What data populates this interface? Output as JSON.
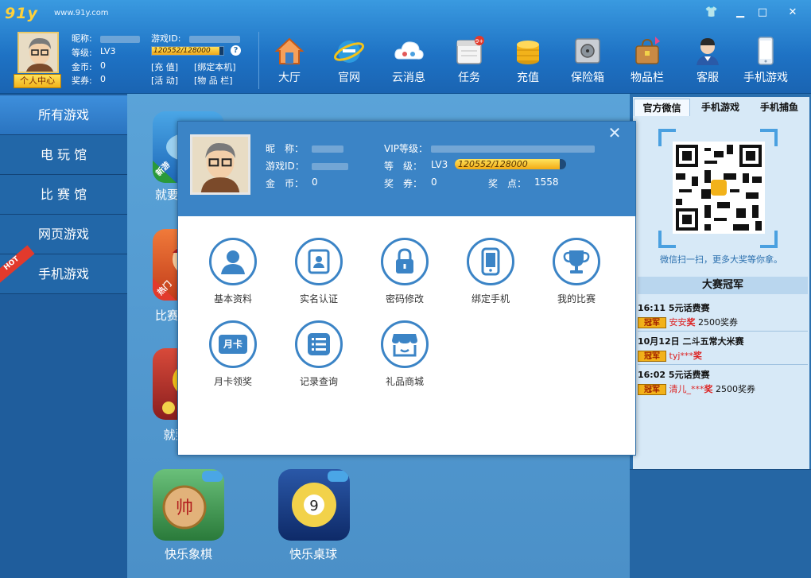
{
  "app": {
    "logo": "91y",
    "site": "www.91y.com"
  },
  "window_controls": {
    "skin": "👕",
    "min": "▁",
    "max": "□",
    "close": "✕"
  },
  "user": {
    "nickname_label": "昵称:",
    "gameid_label": "游戏ID:",
    "level_label": "等级:",
    "level_value": "LV3",
    "exp_text": "120552/128000",
    "exp_fraction": 0.942,
    "gold_label": "金币:",
    "gold_value": "0",
    "coupon_label": "奖券:",
    "coupon_value": "0",
    "recharge": "[充 值]",
    "bind": "[绑定本机]",
    "activity": "[活 动]",
    "bag": "[物 品 栏]",
    "center_btn": "个人中心",
    "help": "?"
  },
  "nav": [
    {
      "label": "大厅",
      "icon": "house-icon",
      "color": "#f07a3a"
    },
    {
      "label": "官网",
      "icon": "ie-icon",
      "color": "#2b9be0"
    },
    {
      "label": "云消息",
      "icon": "cloud-icon",
      "color": "#ffffff"
    },
    {
      "label": "任务",
      "icon": "calendar-icon",
      "color": "#f4f4f4",
      "badge": "9+"
    },
    {
      "label": "充值",
      "icon": "coins-icon",
      "color": "#f2b21a"
    },
    {
      "label": "保险箱",
      "icon": "safe-icon",
      "color": "#c9ced4"
    },
    {
      "label": "物品栏",
      "icon": "bag-icon",
      "color": "#c98a44"
    },
    {
      "label": "客服",
      "icon": "support-icon",
      "color": "#f1d2b8"
    },
    {
      "label": "手机游戏",
      "icon": "phone-icon",
      "color": "#e6eef6"
    }
  ],
  "sidebar": [
    {
      "label": "所有游戏"
    },
    {
      "label": "电 玩 馆"
    },
    {
      "label": "比 赛 馆"
    },
    {
      "label": "网页游戏"
    },
    {
      "label": "手机游戏"
    }
  ],
  "hot_badge": "HOT",
  "games": [
    {
      "label": "就要",
      "tag": "新游",
      "color": "#3a8bd0"
    },
    {
      "label": "比赛",
      "tag": "热门",
      "color": "#d8502a"
    },
    {
      "label": "就要疯",
      "tag": "",
      "color": "#c23c3c"
    },
    {
      "label": "快乐象棋",
      "tag": "",
      "color": "#c9944a"
    },
    {
      "label": "快乐桌球",
      "tag": "",
      "color": "#2a58a8"
    }
  ],
  "right": {
    "tabs": [
      "官方微信",
      "手机游戏",
      "手机捕鱼"
    ],
    "scan_text": "微信扫一扫，更多大奖等你拿。",
    "champ_title": "大赛冠军",
    "champions": [
      {
        "event": "16:11 5元话费赛",
        "badge": "冠军",
        "name": "安安",
        "award_word": "奖",
        "prize": "2500奖券"
      },
      {
        "event": "10月12日 二斗五常大米赛",
        "badge": "冠军",
        "name": "tyj***",
        "award_word": "奖",
        "prize": ""
      },
      {
        "event": "16:02 5元话费赛",
        "badge": "冠军",
        "name": "清儿_***",
        "award_word": "奖",
        "prize": "2500奖券"
      }
    ]
  },
  "modal": {
    "close": "✕",
    "nickname_label": "昵　称：",
    "gameid_label": "游戏ID：",
    "gold_label": "金　币：",
    "gold_value": "0",
    "vip_label": "VIP等级：",
    "level_label": "等　级：",
    "level_value": "LV3",
    "exp_text": "120552/128000",
    "exp_fraction": 0.942,
    "coupon_label": "奖　券：",
    "coupon_value": "0",
    "points_label": "奖　点：",
    "points_value": "1558",
    "features": [
      {
        "label": "基本资料",
        "icon": "person-icon"
      },
      {
        "label": "实名认证",
        "icon": "id-card-icon"
      },
      {
        "label": "密码修改",
        "icon": "lock-icon"
      },
      {
        "label": "绑定手机",
        "icon": "phone-icon"
      },
      {
        "label": "我的比赛",
        "icon": "trophy-icon"
      },
      {
        "label": "月卡领奖",
        "icon": "month-card-icon",
        "card_text": "月卡"
      },
      {
        "label": "记录查询",
        "icon": "list-icon"
      },
      {
        "label": "礼品商城",
        "icon": "shop-icon"
      }
    ]
  }
}
